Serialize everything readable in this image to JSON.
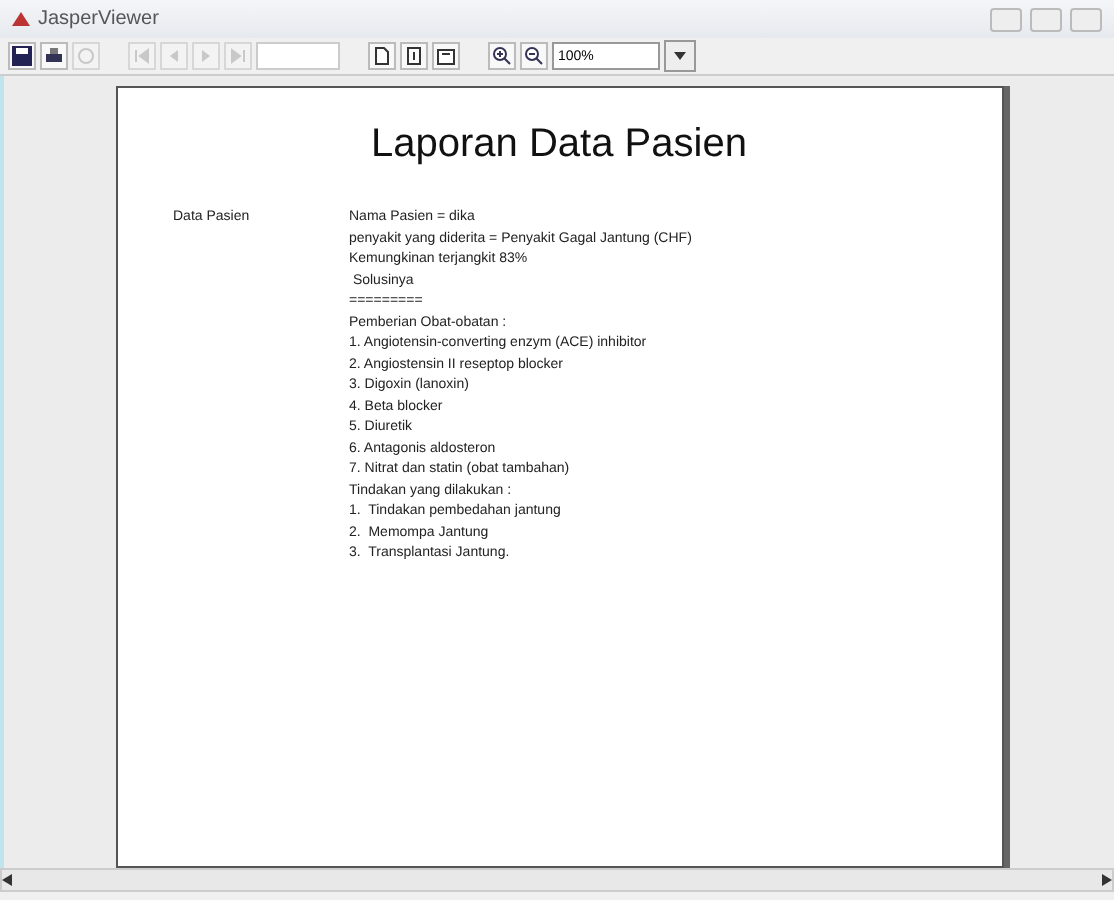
{
  "window": {
    "title": "JasperViewer"
  },
  "toolbar": {
    "zoom": "100%"
  },
  "report": {
    "title": "Laporan Data Pasien",
    "label": "Data Pasien",
    "lines": [
      "Nama Pasien = dika",
      "penyakit yang diderita = Penyakit Gagal Jantung (CHF)",
      "Kemungkinan terjangkit 83%",
      " Solusinya",
      "=========",
      "Pemberian Obat-obatan :",
      "1. Angiotensin-converting enzym (ACE) inhibitor",
      "2. Angiostensin II reseptop blocker",
      "3. Digoxin (lanoxin)",
      "4. Beta blocker",
      "5. Diuretik",
      "6. Antagonis aldosteron",
      "7. Nitrat dan statin (obat tambahan)",
      "Tindakan yang dilakukan :",
      "1.  Tindakan pembedahan jantung",
      "2.  Memompa Jantung",
      "3.  Transplantasi Jantung."
    ]
  }
}
